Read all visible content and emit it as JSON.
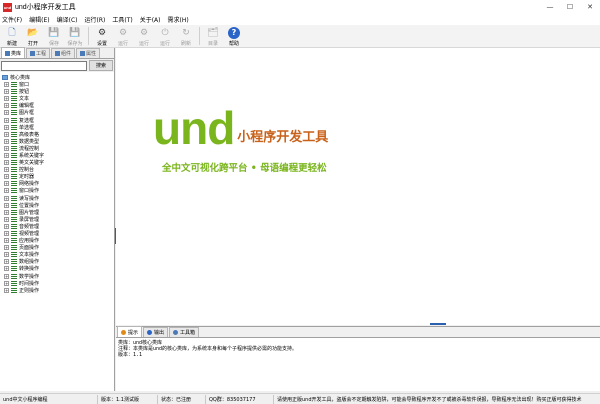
{
  "window": {
    "app_icon_text": "und",
    "title": "und小程序开发工具",
    "minimize": "—",
    "maximize": "☐",
    "close": "✕"
  },
  "menu": [
    "文件(F)",
    "编辑(E)",
    "编译(C)",
    "运行(R)",
    "工具(T)",
    "关于(A)",
    "需求(H)"
  ],
  "toolbar": [
    {
      "label": "新建",
      "icon": "new-file-icon",
      "glyph": "🗋",
      "enabled": true,
      "color": "#3a6fb5"
    },
    {
      "label": "打开",
      "icon": "open-folder-icon",
      "glyph": "📂",
      "enabled": true,
      "color": "#d9a21b"
    },
    {
      "label": "保存",
      "icon": "save-icon",
      "glyph": "💾",
      "enabled": false,
      "color": "#555555"
    },
    {
      "label": "保存为",
      "icon": "save-as-icon",
      "glyph": "💾",
      "enabled": false,
      "color": "#555555"
    },
    {
      "label": "设置",
      "icon": "gear-icon",
      "glyph": "⚙",
      "enabled": true,
      "color": "#333333"
    },
    {
      "label": "运行",
      "icon": "run-icon",
      "glyph": "⚙",
      "enabled": false,
      "color": "#555555"
    },
    {
      "label": "运行",
      "icon": "run-compile-icon",
      "glyph": "⚙",
      "enabled": false,
      "color": "#555555"
    },
    {
      "label": "运行",
      "icon": "run-debug-icon",
      "glyph": "⏻",
      "enabled": false,
      "color": "#555555"
    },
    {
      "label": "刷新",
      "icon": "refresh-icon",
      "glyph": "↻",
      "enabled": false,
      "color": "#555555"
    },
    {
      "label": "目录",
      "icon": "catalog-icon",
      "glyph": "🗂",
      "enabled": false,
      "color": "#555555"
    },
    {
      "label": "帮助",
      "icon": "help-icon",
      "glyph": "?",
      "enabled": true,
      "color": "#2b64c8"
    }
  ],
  "left_pane": {
    "tabs": [
      "类库",
      "工程",
      "组件",
      "属性"
    ],
    "search_button": "搜索",
    "search_value": "",
    "root": "核心类库",
    "items": [
      "窗口",
      "按钮",
      "文本",
      "编辑框",
      "图片框",
      "复选框",
      "单选框",
      "高级表格",
      "数据类型",
      "流程控制",
      "系统关键字",
      "英文关键字",
      "控制台",
      "定时器",
      "网络操作",
      "窗口操作",
      "读写操作",
      "位置操作",
      "图片管理",
      "录屏管理",
      "音频管理",
      "视频管理",
      "应用操作",
      "页面操作",
      "文本操作",
      "数组操作",
      "转换操作",
      "数学操作",
      "时间操作",
      "正则操作"
    ]
  },
  "main": {
    "logo_und": "und",
    "logo_title": "小程序开发工具",
    "slogan": "全中文可视化跨平台 • 母语编程更轻松"
  },
  "bottom_pane": {
    "tabs": [
      {
        "label": "提示",
        "color": "#e08a1a"
      },
      {
        "label": "输出",
        "color": "#2b64c8"
      },
      {
        "label": "工具箱",
        "color": "#4a7ab8"
      }
    ],
    "lines": [
      "类库：und核心类库",
      "注释：本类库是und的核心类库，为系统本身和每个子程序提供必需的功能支持。",
      "版本：1.1"
    ]
  },
  "status": {
    "app": "und中文小程序编程",
    "version": "版本：1.1测试版",
    "state": "状态：已注册",
    "qq": "QQ群：835037177",
    "notice": "请使用正版und开发工具，盗版会不定期触发陷阱，可能会导致程序开发不了或被杀毒软件误报，导致程序无法出现！购买正版可获得技术"
  }
}
